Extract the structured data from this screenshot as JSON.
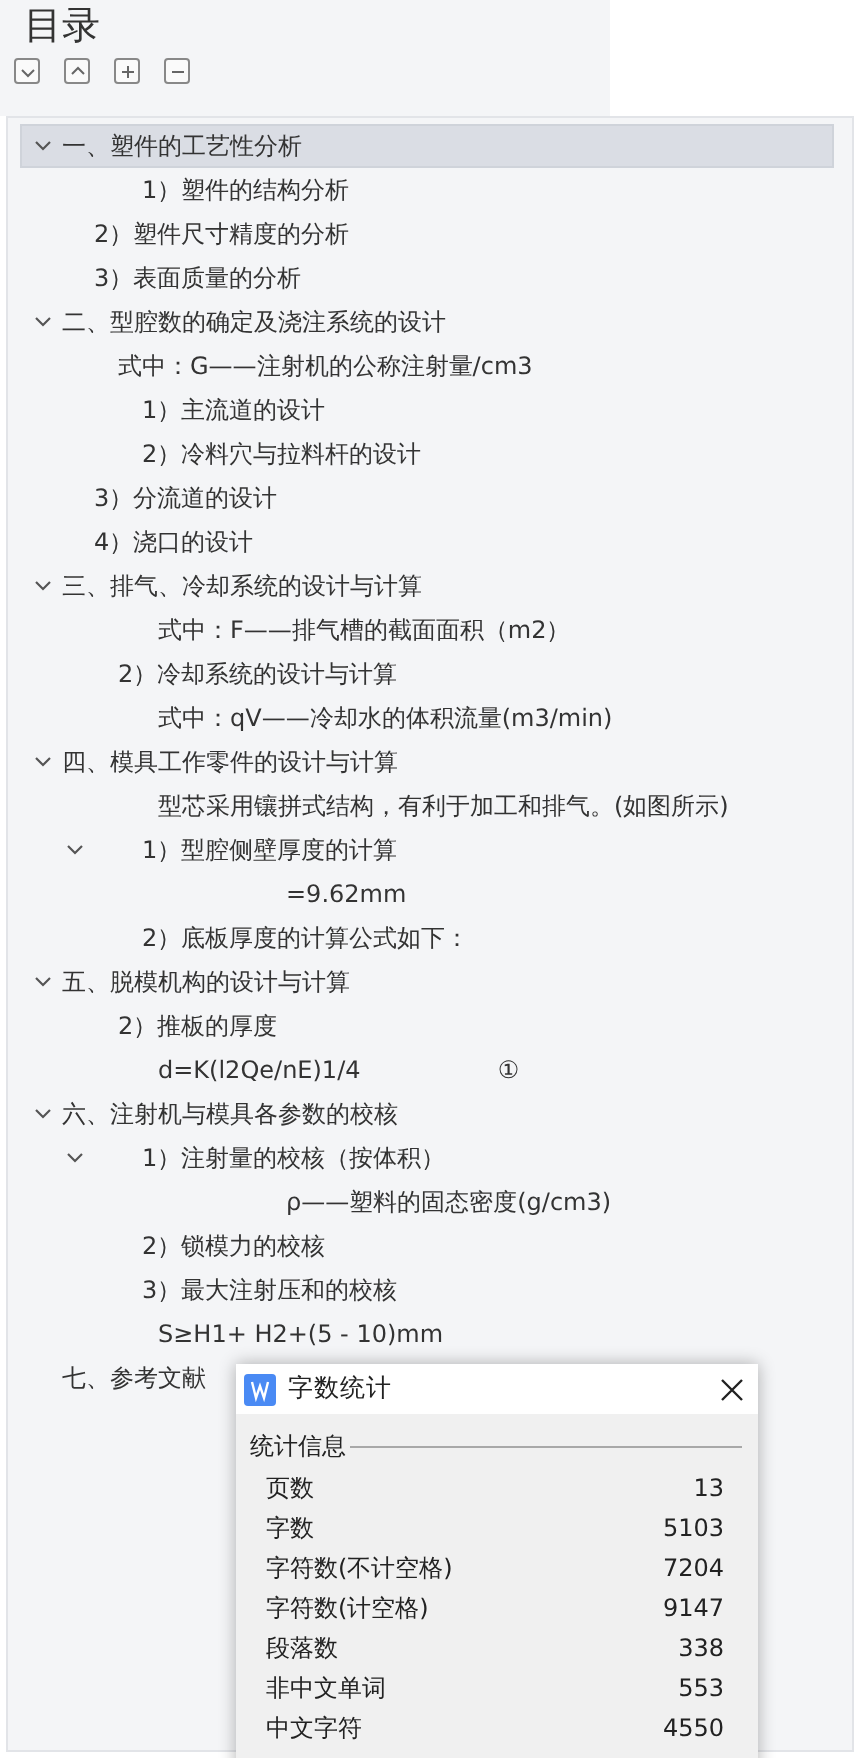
{
  "title": "目录",
  "toolbar": [
    {
      "kind": "expand"
    },
    {
      "kind": "collapse"
    },
    {
      "kind": "plus"
    },
    {
      "kind": "minus"
    }
  ],
  "toc": [
    {
      "text": "一、塑件的工艺性分析",
      "selected": true,
      "expanded": true,
      "children": [
        {
          "text": "1）塑件的结构分析",
          "kind": "item"
        },
        {
          "text": "2）塑件尺寸精度的分析",
          "kind": "section"
        },
        {
          "text": "3）表面质量的分析",
          "kind": "section"
        }
      ]
    },
    {
      "text": "二、型腔数的确定及浇注系统的设计",
      "selected": false,
      "expanded": true,
      "children": [
        {
          "text": "式中：G——注射机的公称注射量/cm3",
          "kind": "step"
        },
        {
          "text": "1）主流道的设计",
          "kind": "item"
        },
        {
          "text": "2）冷料穴与拉料杆的设计",
          "kind": "item"
        },
        {
          "text": "3）分流道的设计",
          "kind": "section"
        },
        {
          "text": "4）浇口的设计",
          "kind": "section"
        }
      ]
    },
    {
      "text": "三、排气、冷却系统的设计与计算",
      "selected": false,
      "expanded": true,
      "children": [
        {
          "text": "式中：F——排气槽的截面面积（m2）",
          "kind": "formula"
        },
        {
          "text": "2）冷却系统的设计与计算",
          "kind": "step"
        },
        {
          "text": "式中：qV——冷却水的体积流量(m3/min)",
          "kind": "formula"
        }
      ]
    },
    {
      "text": "四、模具工作零件的设计与计算",
      "selected": false,
      "expanded": true,
      "children": [
        {
          "text": "型芯采用镶拼式结构，有利于加工和排气。(如图所示)",
          "kind": "formula"
        },
        {
          "text": "1）型腔侧壁厚度的计算",
          "kind": "item",
          "expanded": true,
          "children": [
            {
              "text": "=9.62mm",
              "kind": "result"
            }
          ]
        },
        {
          "text": "2）底板厚度的计算公式如下：",
          "kind": "item"
        }
      ]
    },
    {
      "text": "五、脱模机构的设计与计算",
      "selected": false,
      "expanded": true,
      "children": [
        {
          "text": "2）推板的厚度",
          "kind": "step"
        },
        {
          "text": "d=K(l2Qe/nE)1/4                  ①",
          "kind": "formula"
        }
      ]
    },
    {
      "text": "六、注射机与模具各参数的校核",
      "selected": false,
      "expanded": true,
      "children": [
        {
          "text": "1）注射量的校核（按体积）",
          "kind": "item",
          "expanded": true,
          "children": [
            {
              "text": "ρ——塑料的固态密度(g/cm3)",
              "kind": "result"
            }
          ]
        },
        {
          "text": "2）锁模力的校核",
          "kind": "item"
        },
        {
          "text": "3）最大注射压和的校核",
          "kind": "item"
        },
        {
          "text": "S≥H1+ H2+(5 - 10)mm",
          "kind": "formula"
        }
      ]
    },
    {
      "text": "七、参考文献",
      "selected": false
    }
  ],
  "dialog": {
    "title": "字数统计",
    "group": "统计信息",
    "stats": [
      {
        "label": "页数",
        "value": "13"
      },
      {
        "label": "字数",
        "value": "5103"
      },
      {
        "label": "字符数(不计空格)",
        "value": "7204"
      },
      {
        "label": "字符数(计空格)",
        "value": "9147"
      },
      {
        "label": "段落数",
        "value": "338"
      },
      {
        "label": "非中文单词",
        "value": "553"
      },
      {
        "label": "中文字符",
        "value": "4550"
      }
    ]
  }
}
